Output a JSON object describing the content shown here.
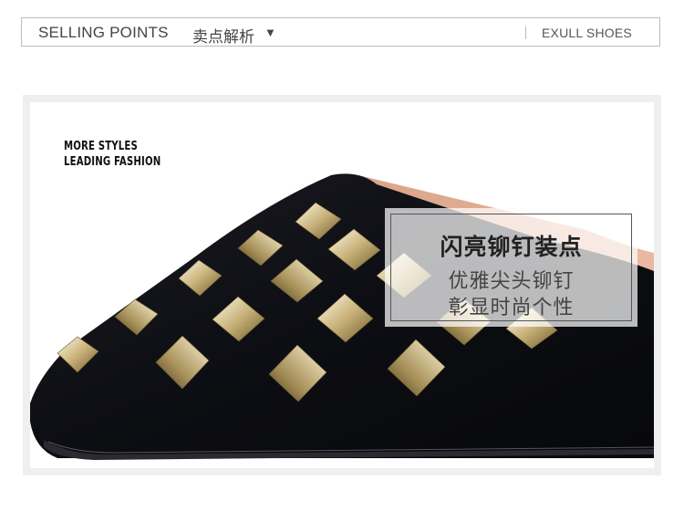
{
  "header": {
    "title_en": "SELLING POINTS",
    "title_cn": "卖点解析",
    "dropdown_arrow": "▼",
    "brand": "EXULL SHOES"
  },
  "image": {
    "tagline": [
      "MORE STYLES",
      "LEADING FASHION"
    ],
    "callout": {
      "title": "闪亮铆钉装点",
      "lines": [
        "优雅尖头铆钉",
        "彰显时尚个性"
      ]
    }
  }
}
